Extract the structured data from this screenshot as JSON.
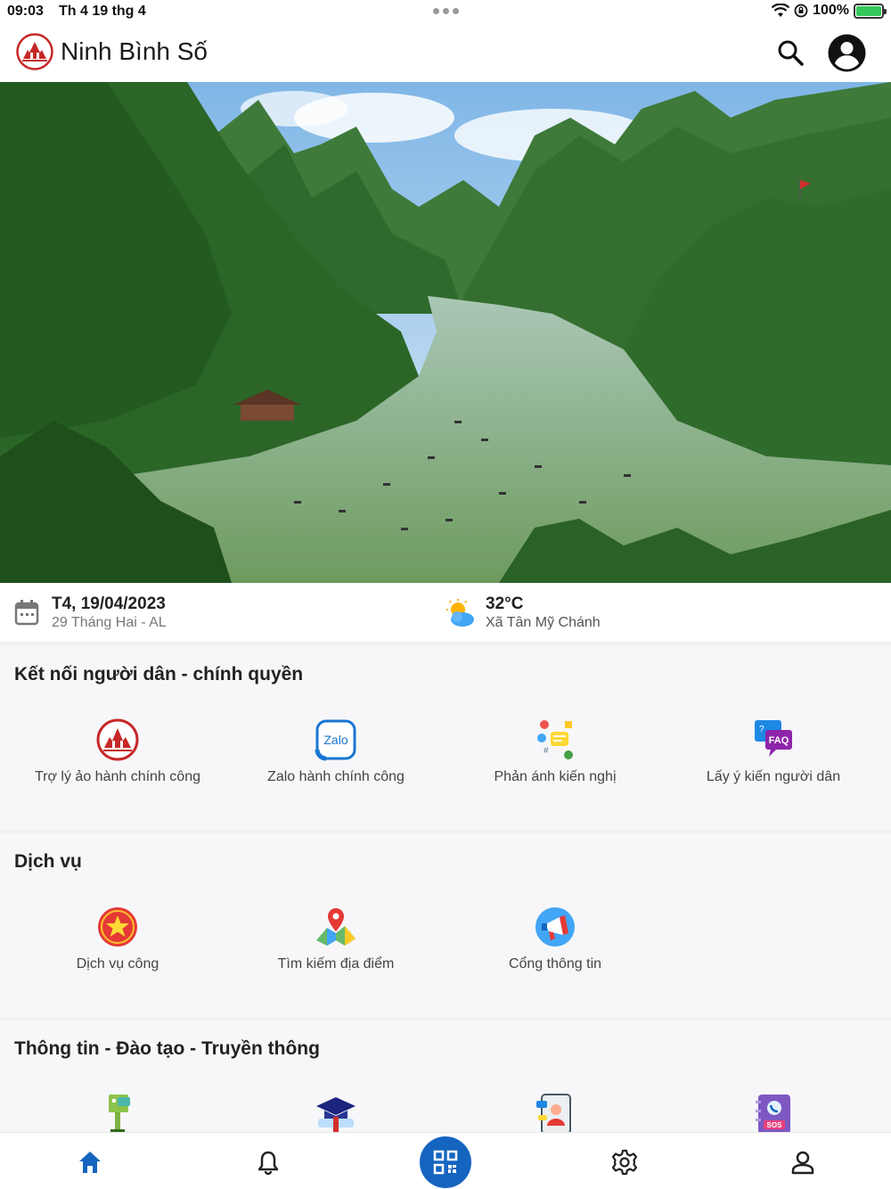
{
  "status_bar": {
    "time": "09:03",
    "date": "Th 4 19 thg 4",
    "battery": "100%"
  },
  "header": {
    "title": "Ninh Bình Số",
    "brand_color": "#c62828"
  },
  "info": {
    "date": "T4, 19/04/2023",
    "lunar": "29 Tháng Hai - AL",
    "temperature": "32°C",
    "location": "Xã Tân Mỹ Chánh"
  },
  "sections": {
    "connect": {
      "title": "Kết nối người dân - chính quyền",
      "items": [
        {
          "label": "Trợ lý ảo hành chính công",
          "icon": "virtual-assistant-icon"
        },
        {
          "label": "Zalo hành chính công",
          "icon": "zalo-icon"
        },
        {
          "label": "Phản ánh kiến nghị",
          "icon": "feedback-icon"
        },
        {
          "label": "Lấy ý kiến người dân",
          "icon": "faq-icon"
        }
      ]
    },
    "services": {
      "title": "Dịch vụ",
      "items": [
        {
          "label": "Dịch vụ công",
          "icon": "public-service-icon"
        },
        {
          "label": "Tìm kiếm địa điểm",
          "icon": "map-search-icon"
        },
        {
          "label": "Cổng thông tin",
          "icon": "portal-icon"
        }
      ]
    },
    "info_training": {
      "title": "Thông tin - Đào tạo - Truyền thông",
      "items": [
        {
          "label": "",
          "icon": "kiosk-icon"
        },
        {
          "label": "",
          "icon": "graduation-cap-icon"
        },
        {
          "label": "",
          "icon": "tablet-user-icon"
        },
        {
          "label": "",
          "icon": "sos-book-icon"
        }
      ]
    }
  },
  "bottom_nav": {
    "items": [
      "home-icon",
      "bell-icon",
      "qr-code-icon",
      "settings-icon",
      "user-icon"
    ],
    "active_color": "#1565c0"
  }
}
